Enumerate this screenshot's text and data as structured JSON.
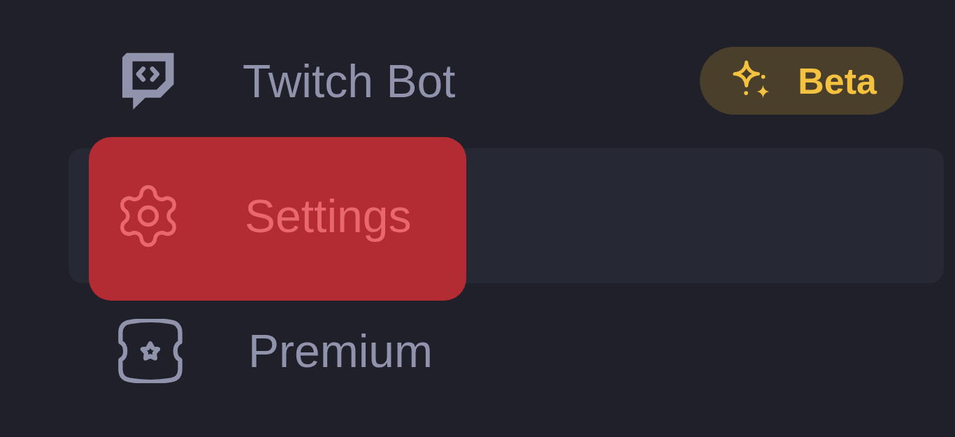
{
  "menu": {
    "items": [
      {
        "label": "Twitch Bot",
        "selected": false,
        "highlighted": false,
        "badge": {
          "label": "Beta"
        }
      },
      {
        "label": "Settings",
        "selected": true,
        "highlighted": true
      },
      {
        "label": "Premium",
        "selected": false,
        "highlighted": false
      }
    ]
  }
}
